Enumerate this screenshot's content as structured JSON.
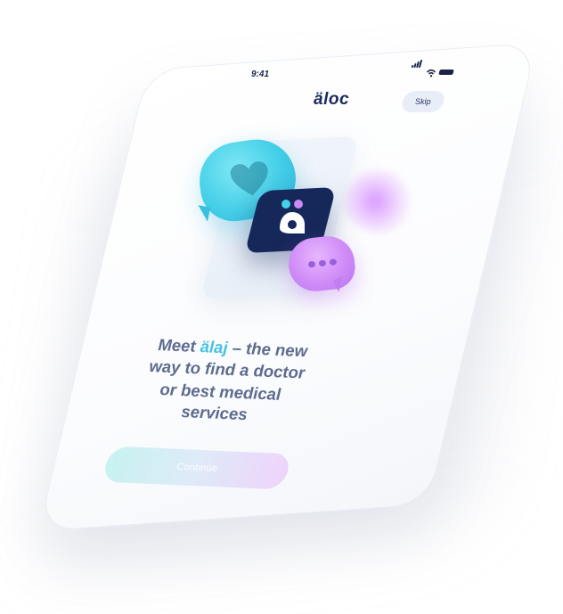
{
  "status_bar": {
    "time": "9:41",
    "icons": [
      "cellular-signal-icon",
      "wifi-icon",
      "battery-icon"
    ]
  },
  "header": {
    "logo_text": "äloc",
    "skip_label": "Skip"
  },
  "illustration": {
    "icons": [
      "heart-chat-bubble-icon",
      "app-logo-icon",
      "typing-chat-bubble-icon"
    ]
  },
  "headline": {
    "line1_prefix": "Meet ",
    "line1_accent": "älaj",
    "line1_suffix": " – the new",
    "line2": "way to find a doctor",
    "line3": "or best medical",
    "line4": "services"
  },
  "cta": {
    "continue_label": "Continue"
  },
  "colors": {
    "brand_navy": "#16275a",
    "accent_cyan": "#48c2e2",
    "accent_purple": "#c98af5",
    "text_muted": "#5d6c8e"
  }
}
